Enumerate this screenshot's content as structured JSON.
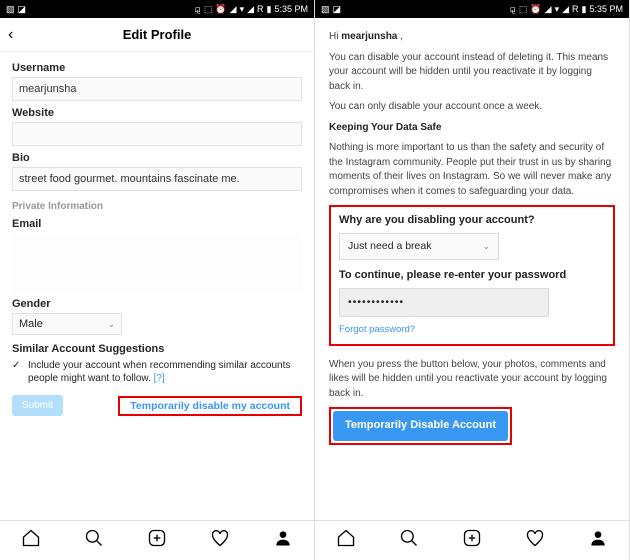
{
  "status": {
    "time": "5:35 PM",
    "net": "R"
  },
  "left": {
    "title": "Edit Profile",
    "username_label": "Username",
    "username_value": "mearjunsha",
    "website_label": "Website",
    "website_value": "",
    "bio_label": "Bio",
    "bio_value": "street food gourmet. mountains fascinate me.",
    "private_label": "Private Information",
    "email_label": "Email",
    "gender_label": "Gender",
    "gender_value": "Male",
    "similar_heading": "Similar Account Suggestions",
    "similar_text": "Include your account when recommending similar accounts people might want to follow.",
    "similar_help": "[?]",
    "submit": "Submit",
    "temp_link": "Temporarily disable my account"
  },
  "right": {
    "greeting_pre": "Hi ",
    "greeting_name": "mearjunsha",
    "greeting_post": " ,",
    "p1": "You can disable your account instead of deleting it. This means your account will be hidden until you reactivate it by logging back in.",
    "p2": "You can only disable your account once a week.",
    "h1": "Keeping Your Data Safe",
    "p3": "Nothing is more important to us than the safety and security of the Instagram community. People put their trust in us by sharing moments of their lives on Instagram. So we will never make any compromises when it comes to safeguarding your data.",
    "q1": "Why are you disabling your account?",
    "reason": "Just need a break",
    "q2": "To continue, please re-enter your password",
    "pwd": "••••••••••••",
    "forgot": "Forgot password?",
    "p4": "When you press the button below, your photos, comments and likes will be hidden until you reactivate your account by logging back in.",
    "btn": "Temporarily Disable Account"
  }
}
